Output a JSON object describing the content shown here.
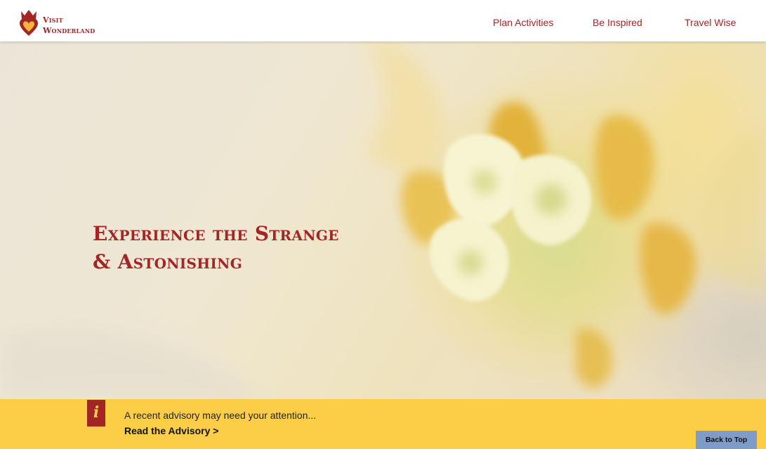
{
  "header": {
    "logo_line1": "Visit",
    "logo_line2": "Wonderland",
    "nav": [
      {
        "label": "Plan Activities"
      },
      {
        "label": "Be Inspired"
      },
      {
        "label": "Travel Wise"
      }
    ]
  },
  "hero": {
    "title_line1": "Experience the Strange",
    "title_line2": "& Astonishing"
  },
  "advisory": {
    "icon_glyph": "i",
    "text": "A recent advisory may need your attention...",
    "link": "Read the Advisory >"
  },
  "back_to_top": "Back to Top",
  "colors": {
    "brand_red": "#a32627",
    "advisory_yellow": "#fcce47",
    "back_to_top_blue": "#7e9cc8"
  },
  "icons": [
    "crowned-heart-logo-icon",
    "info-icon"
  ]
}
